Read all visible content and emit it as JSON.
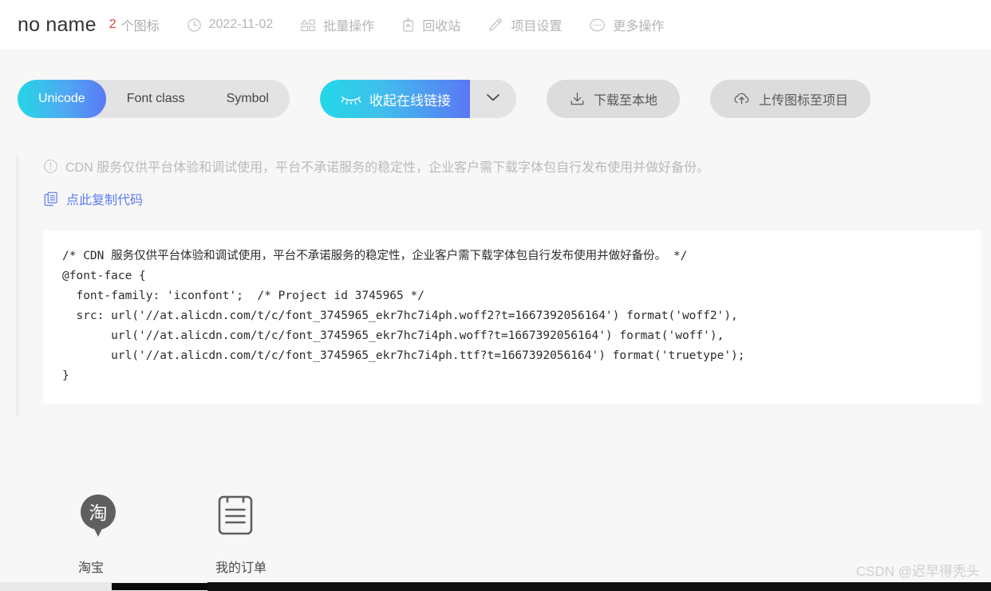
{
  "header": {
    "project_title": "no name",
    "icon_count": "2",
    "icon_count_label": "个图标",
    "items": [
      {
        "icon": "clock-icon",
        "label": "2022-11-02"
      },
      {
        "icon": "batch-operation-icon",
        "label": "批量操作"
      },
      {
        "icon": "recycle-bin-icon",
        "label": "回收站"
      },
      {
        "icon": "pencil-icon",
        "label": "项目设置"
      },
      {
        "icon": "more-icon",
        "label": "更多操作"
      }
    ]
  },
  "toolbar": {
    "segments": [
      {
        "label": "Unicode",
        "active": true
      },
      {
        "label": "Font class",
        "active": false
      },
      {
        "label": "Symbol",
        "active": false
      }
    ],
    "link_button": {
      "icon": "eye-closed-icon",
      "label": "收起在线链接",
      "caret_icon": "chevron-down-icon"
    },
    "download_button": {
      "icon": "download-icon",
      "label": "下载至本地"
    },
    "upload_button": {
      "icon": "cloud-upload-icon",
      "label": "上传图标至项目"
    }
  },
  "panel": {
    "notice_icon": "exclamation-circle-icon",
    "notice": "CDN 服务仅供平台体验和调试使用，平台不承诺服务的稳定性，企业客户需下载字体包自行发布使用并做好备份。",
    "copy_icon": "copy-icon",
    "copy_label": "点此复制代码",
    "code": "/* CDN 服务仅供平台体验和调试使用，平台不承诺服务的稳定性，企业客户需下载字体包自行发布使用并做好备份。 */\n@font-face {\n  font-family: 'iconfont';  /* Project id 3745965 */\n  src: url('//at.alicdn.com/t/c/font_3745965_ekr7hc7i4ph.woff2?t=1667392056164') format('woff2'),\n       url('//at.alicdn.com/t/c/font_3745965_ekr7hc7i4ph.woff?t=1667392056164') format('woff'),\n       url('//at.alicdn.com/t/c/font_3745965_ekr7hc7i4ph.ttf?t=1667392056164') format('truetype');\n}"
  },
  "icons": [
    {
      "glyph": "taobao-pin-icon",
      "name": "淘宝"
    },
    {
      "glyph": "order-list-icon",
      "name": "我的订单"
    }
  ],
  "watermark": "CSDN @迟早得秃头",
  "colors": {
    "page_bg": "#f7f7f7",
    "accent_cyan": "#22d8e8",
    "accent_blue": "#5b77f5",
    "link": "#5b7cf6",
    "count_red": "#e03c31",
    "muted_text": "#b4b4b4"
  }
}
